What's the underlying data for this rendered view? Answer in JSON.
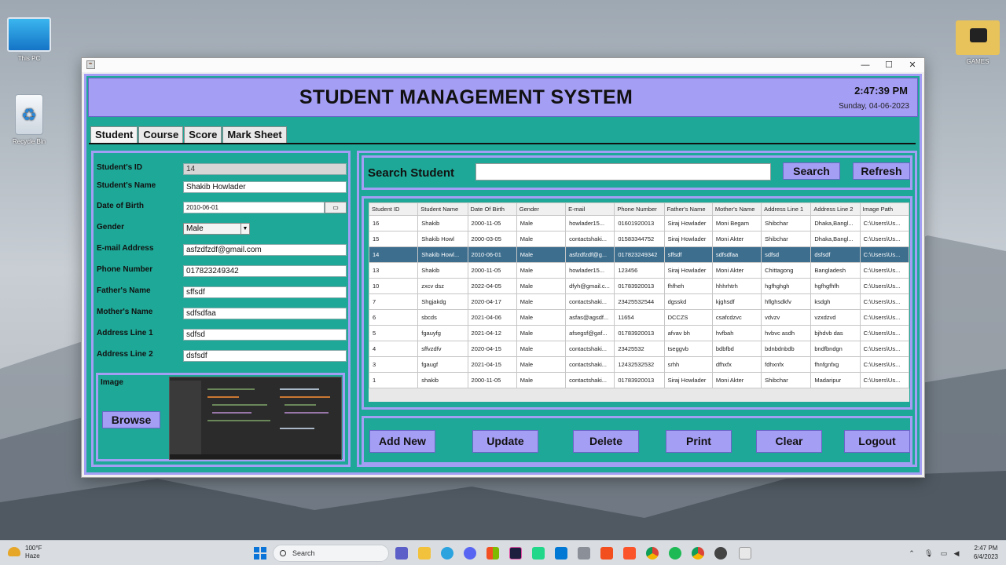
{
  "desktop": {
    "icons": [
      {
        "label": "This PC"
      },
      {
        "label": "Recycle Bin"
      },
      {
        "label": "GAMES"
      }
    ]
  },
  "window": {
    "controls": {
      "minimize": "—",
      "maximize": "☐",
      "close": "✕"
    }
  },
  "header": {
    "title": "STUDENT MANAGEMENT SYSTEM",
    "time": "2:47:39 PM",
    "date": "Sunday, 04-06-2023"
  },
  "tabs": [
    "Student",
    "Course",
    "Score",
    "Mark Sheet"
  ],
  "form": {
    "student_id_label": "Student's ID",
    "student_id": "14",
    "name_label": "Student's Name",
    "name": "Shakib Howlader",
    "dob_label": "Date of Birth",
    "dob": "2010-06-01",
    "gender_label": "Gender",
    "gender": "Male",
    "email_label": "E-mail Address",
    "email": "asfzdfzdf@gmail.com",
    "phone_label": "Phone Number",
    "phone": "017823249342",
    "father_label": "Father's Name",
    "father": "sffsdf",
    "mother_label": "Mother's Name",
    "mother": "sdfsdfaa",
    "addr1_label": "Address Line 1",
    "addr1": "sdfsd",
    "addr2_label": "Address Line 2",
    "addr2": "dsfsdf",
    "image_label": "Image",
    "browse_label": "Browse"
  },
  "search": {
    "label": "Search Student",
    "value": "",
    "search_button": "Search",
    "refresh_button": "Refresh"
  },
  "table": {
    "columns": [
      "Student ID",
      "Student Name",
      "Date Of Birth",
      "Gender",
      "E-mail",
      "Phone Number",
      "Father's Name",
      "Mother's Name",
      "Address Line 1",
      "Address Line 2",
      "Image Path"
    ],
    "rows": [
      [
        "16",
        "Shakib",
        "2000-11-05",
        "Male",
        "howlader15...",
        "01601920013",
        "Siraj Howlader",
        "Moni Begam",
        "Shibchar",
        "Dhaka,Bangl...",
        "C:\\Users\\Us..."
      ],
      [
        "15",
        "Shakib Howl",
        "2000-03-05",
        "Male",
        "contactshaki...",
        "01583344752",
        "Siraj Howlader",
        "Moni Akter",
        "Shibchar",
        "Dhaka,Bangl...",
        "C:\\Users\\Us..."
      ],
      [
        "14",
        "Shakib Howl...",
        "2010-06-01",
        "Male",
        "asfzdfzdf@g...",
        "017823249342",
        "sffsdf",
        "sdfsdfaa",
        "sdfsd",
        "dsfsdf",
        "C:\\Users\\Us..."
      ],
      [
        "13",
        "Shakib",
        "2000-11-05",
        "Male",
        "howlader15...",
        "123456",
        "Siraj Howlader",
        "Moni Akter",
        "Chittagong",
        "Bangladesh",
        "C:\\Users\\Us..."
      ],
      [
        "10",
        "zxcv dsz",
        "2022-04-05",
        "Male",
        "dfyh@gmail.c...",
        "01783920013",
        "fhfheh",
        "hhhrhtrh",
        "hgfhghgh",
        "hgfhgfhfh",
        "C:\\Users\\Us..."
      ],
      [
        "7",
        "Shgjakdg",
        "2020-04-17",
        "Male",
        "contactshaki...",
        "23425532544",
        "dgsskd",
        "kjghsdf",
        "hflghsdkfv",
        "ksdgh",
        "C:\\Users\\Us..."
      ],
      [
        "6",
        "sbcds",
        "2021-04-06",
        "Male",
        "asfas@agsdf...",
        "11654",
        "DCCZS",
        "csafcdzvc",
        "vdvzv",
        "vzxdzvd",
        "C:\\Users\\Us..."
      ],
      [
        "5",
        "fgauyfg",
        "2021-04-12",
        "Male",
        "afsegsf@gaf...",
        "01783920013",
        "afvav bh",
        "hvfbah",
        "hvbvc asdh",
        "bjhdvb das",
        "C:\\Users\\Us..."
      ],
      [
        "4",
        "sffvzdfv",
        "2020-04-15",
        "Male",
        "contactshaki...",
        "23425532",
        "tseggvb",
        "bdbfbd",
        "bdnbdnbdb",
        "bndfbndgn",
        "C:\\Users\\Us..."
      ],
      [
        "3",
        "fgaugf",
        "2021-04-15",
        "Male",
        "contactshaki...",
        "12432532532",
        "srhh",
        "dfhxfx",
        "fdhxnfx",
        "fhnfgnfxg",
        "C:\\Users\\Us..."
      ],
      [
        "1",
        "shakib",
        "2000-11-05",
        "Male",
        "contactshaki...",
        "01783920013",
        "Siraj Howlader",
        "Moni Akter",
        "Shibchar",
        "Madaripur",
        "C:\\Users\\Us..."
      ]
    ],
    "selected_row": 2
  },
  "actions": [
    "Add New",
    "Update",
    "Delete",
    "Print",
    "Clear",
    "Logout"
  ],
  "taskbar": {
    "weather_temp": "100°F",
    "weather_desc": "Haze",
    "search_placeholder": "Search",
    "clock_time": "2:47 PM",
    "clock_date": "6/4/2023"
  },
  "colors": {
    "lavender": "#a59ef5",
    "teal": "#1ea897",
    "selected_row": "#3d6e8e"
  }
}
